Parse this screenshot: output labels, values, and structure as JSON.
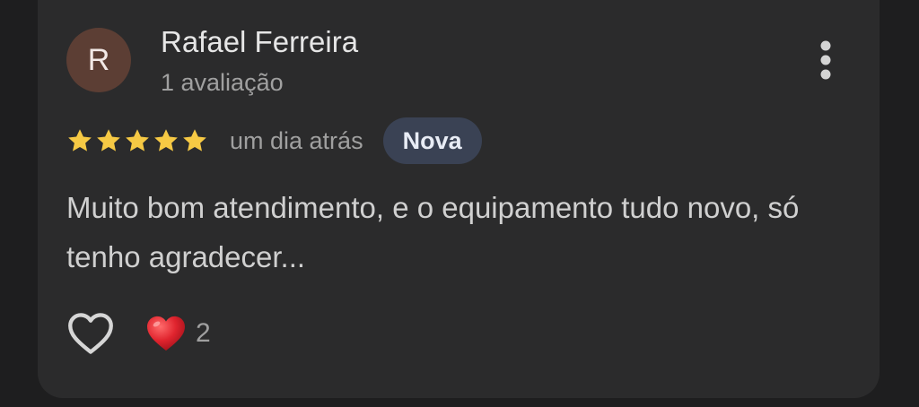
{
  "review": {
    "avatar_letter": "R",
    "author_name": "Rafael Ferreira",
    "author_review_count": "1 avaliação",
    "rating": 5,
    "rating_max": 5,
    "time_ago": "um dia atrás",
    "badge": "Nova",
    "text": "Muito bom atendimento, e o equipamento tudo novo, só tenho agradecer...",
    "reaction_count": "2"
  },
  "icons": {
    "more": "more-vert-icon",
    "star": "star-icon",
    "like": "heart-outline-icon",
    "reaction": "red-heart-icon"
  },
  "colors": {
    "background": "#1e1e1f",
    "card": "#2b2b2c",
    "avatar": "#5c3e34",
    "star": "#f6c944",
    "badge": "#3a4254",
    "reaction_heart": "#e0242e"
  }
}
